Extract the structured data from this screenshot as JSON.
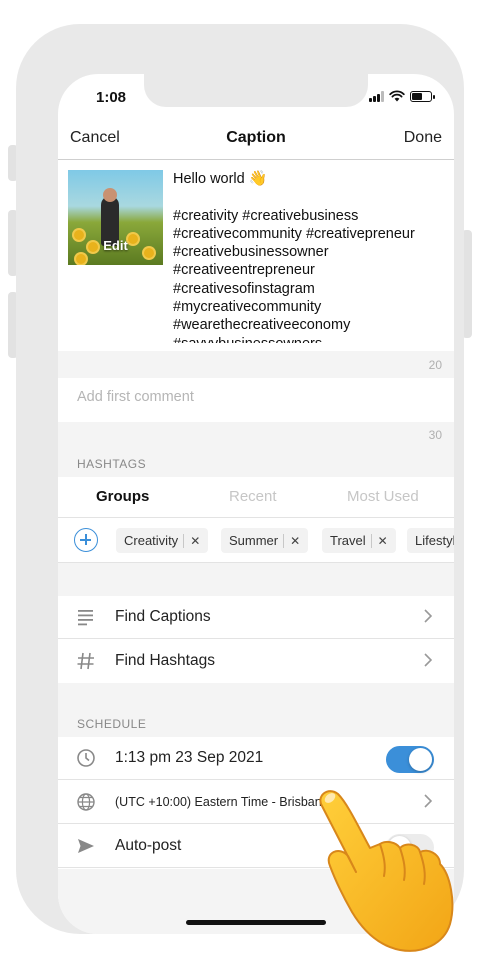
{
  "status_bar": {
    "time": "1:08"
  },
  "nav": {
    "cancel": "Cancel",
    "title": "Caption",
    "done": "Done"
  },
  "caption": {
    "thumbnail_label": "Edit",
    "first_line": "Hello world",
    "first_line_emoji": "👋",
    "hashtags": [
      "#creativity #creativebusiness",
      "#creativecommunity #creativepreneur",
      "#creativebusinessowner",
      "#creativeentrepreneur",
      "#creativesofinstagram",
      "#mycreativecommunity",
      "#wearethecreativeeconomy",
      "#savvybusinessowners"
    ],
    "counter": "20"
  },
  "comment": {
    "placeholder": "Add first comment",
    "counter": "30"
  },
  "hashtags_section": {
    "label": "HASHTAGS",
    "tabs": [
      {
        "label": "Groups",
        "active": true
      },
      {
        "label": "Recent",
        "active": false
      },
      {
        "label": "Most Used",
        "active": false
      }
    ],
    "chips": [
      "Creativity",
      "Summer",
      "Travel",
      "Lifestyle"
    ]
  },
  "tools": [
    {
      "label": "Find Captions",
      "icon": "lines-icon"
    },
    {
      "label": "Find Hashtags",
      "icon": "hash-icon"
    }
  ],
  "schedule": {
    "label": "SCHEDULE",
    "datetime": "1:13 pm  23 Sep 2021",
    "timezone": "(UTC +10:00) Eastern Time - Brisbane",
    "autopost": "Auto-post",
    "datetime_toggle_on": true,
    "autopost_toggle_on": false
  },
  "colors": {
    "accent": "#3b8fd9",
    "frame": "#e9e9e9",
    "muted": "#b5b5b5"
  },
  "overlay": {
    "pointer_emoji_name": "pointing-hand-icon"
  }
}
